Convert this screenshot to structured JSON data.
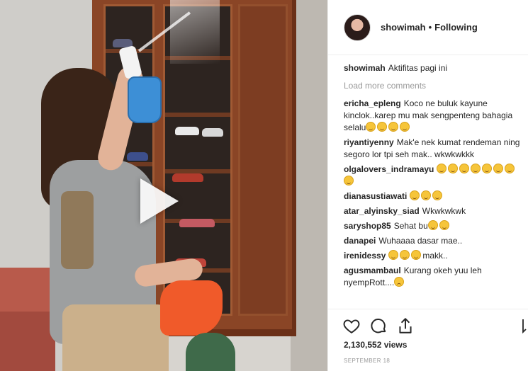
{
  "post": {
    "username": "showimah",
    "dot": "•",
    "follow_state": "Following",
    "caption_user": "showimah",
    "caption_text": "Aktifitas pagi ini",
    "load_more": "Load more comments",
    "views": "2,130,552 views",
    "date": "September 18"
  },
  "comments": [
    {
      "user": "ericha_epleng",
      "text": "Koco ne buluk kayune kinclok..karep mu mak sengpenteng bahagia selalu",
      "emojis": 4,
      "emoji_kind": "laugh"
    },
    {
      "user": "riyantiyenny",
      "text": "Mak'e nek kumat rendeman ning segoro lor tpi seh mak.. wkwkwkkk",
      "emojis": 0,
      "emoji_kind": "laugh"
    },
    {
      "user": "olgalovers_indramayu",
      "text": "",
      "emojis": 8,
      "emoji_kind": "laugh"
    },
    {
      "user": "dianasustiawati",
      "text": "",
      "emojis": 3,
      "emoji_kind": "grin"
    },
    {
      "user": "atar_alyinsky_siad",
      "text": "Wkwkwkwk",
      "emojis": 0,
      "emoji_kind": "laugh"
    },
    {
      "user": "saryshop85",
      "text": "Sehat bu",
      "emojis": 2,
      "emoji_kind": "grin"
    },
    {
      "user": "danapei",
      "text": "Wuhaaaa dasar mae..",
      "emojis": 0,
      "emoji_kind": "laugh"
    },
    {
      "user": "irenidessy",
      "text": "makk..",
      "emojis": 3,
      "emoji_kind": "grin",
      "emoji_first": true
    },
    {
      "user": "agusmambaul",
      "text": "Kurang okeh yuu leh nyempRott....",
      "emojis": 1,
      "emoji_kind": "sad"
    }
  ],
  "icons": {
    "like": "heart-icon",
    "comment": "comment-icon",
    "share": "share-icon",
    "save": "bookmark-icon",
    "play": "play-icon"
  },
  "colors": {
    "text": "#262626",
    "muted": "#999999",
    "border": "#efefef"
  }
}
